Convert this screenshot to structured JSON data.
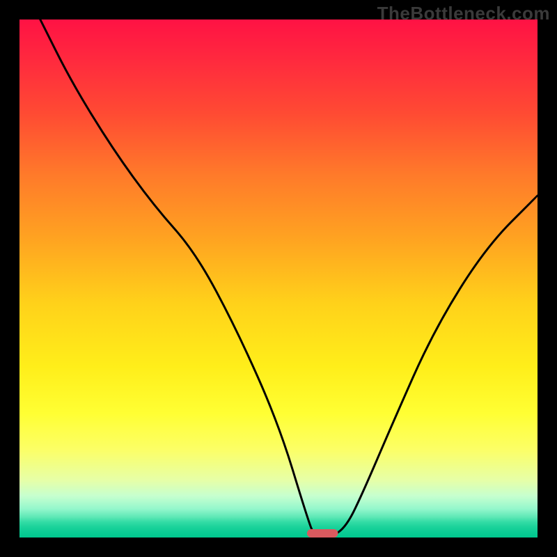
{
  "watermark": "TheBottleneck.com",
  "chart_data": {
    "type": "line",
    "title": "",
    "xlabel": "",
    "ylabel": "",
    "xlim": [
      0,
      100
    ],
    "ylim": [
      0,
      100
    ],
    "grid": false,
    "legend": false,
    "background_gradient": {
      "direction": "vertical",
      "stops": [
        {
          "pos": 0.0,
          "color": "#ff1244"
        },
        {
          "pos": 0.55,
          "color": "#ffd21a"
        },
        {
          "pos": 0.9,
          "color": "#e6ffa8"
        },
        {
          "pos": 1.0,
          "color": "#00c88e"
        }
      ]
    },
    "series": [
      {
        "name": "bottleneck-curve",
        "x": [
          4,
          10,
          18,
          26,
          34,
          42,
          50,
          55.5,
          57,
          60,
          63,
          66,
          72,
          80,
          90,
          100
        ],
        "values": [
          100,
          88,
          75,
          64,
          55,
          40,
          22,
          4,
          0,
          0,
          2,
          8,
          22,
          40,
          56,
          66
        ]
      }
    ],
    "marker": {
      "name": "optimal-point",
      "x_center": 58.5,
      "width": 6,
      "y": 0,
      "color": "#d95a5f"
    }
  }
}
